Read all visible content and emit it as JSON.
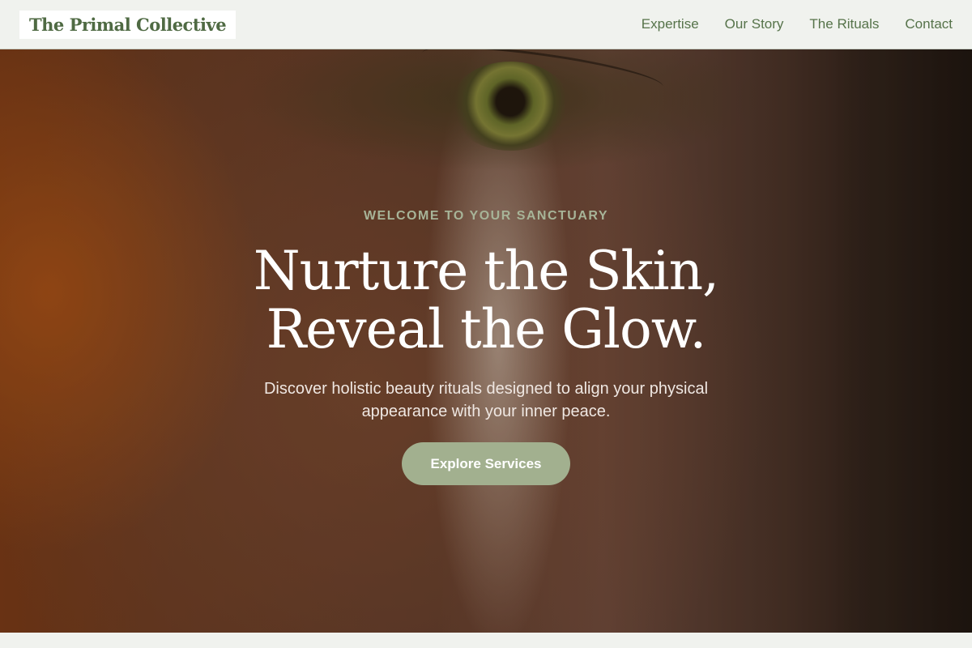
{
  "header": {
    "logo": "The Primal Collective",
    "nav": [
      {
        "label": "Expertise"
      },
      {
        "label": "Our Story"
      },
      {
        "label": "The Rituals"
      },
      {
        "label": "Contact"
      }
    ]
  },
  "hero": {
    "eyebrow": "WELCOME TO YOUR SANCTUARY",
    "headline_line1": "Nurture the Skin,",
    "headline_line2": "Reveal the Glow.",
    "subtext": "Discover holistic beauty rituals designed to align your physical appearance with your inner peace.",
    "cta_label": "Explore Services"
  },
  "colors": {
    "brand_green": "#56734a",
    "button_sage": "#a2b08f",
    "background": "#f0f2ee"
  }
}
